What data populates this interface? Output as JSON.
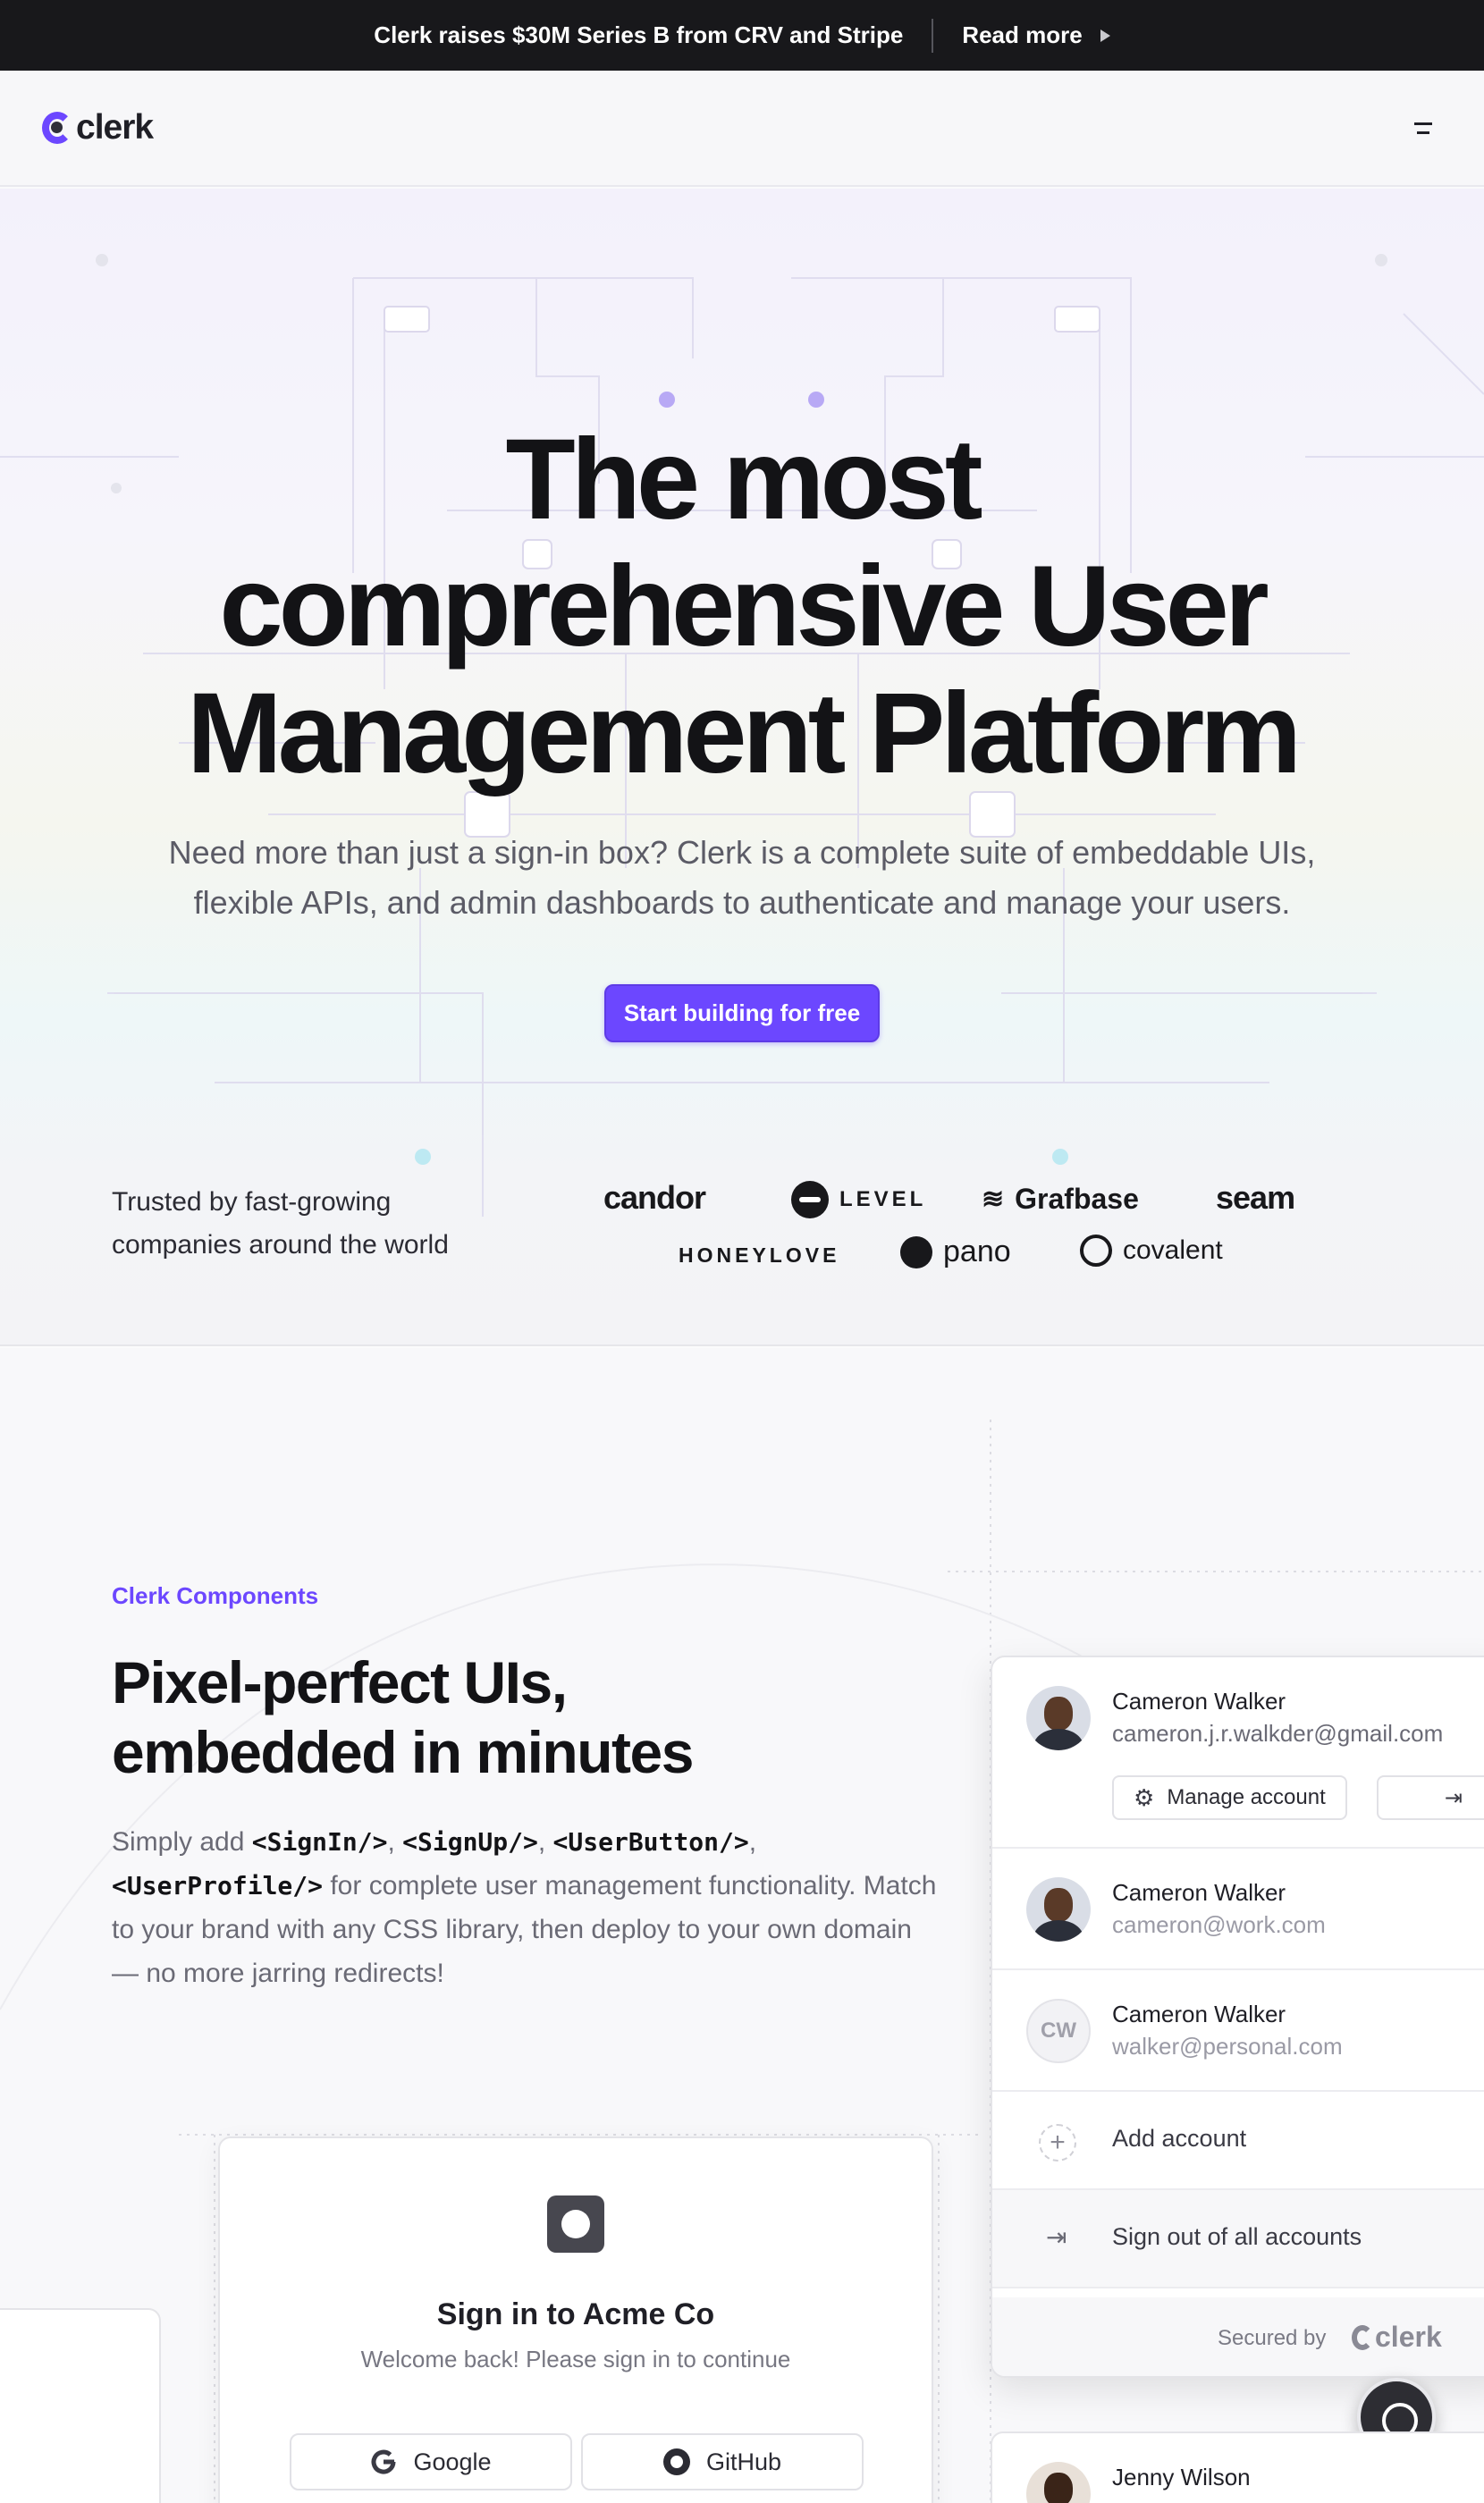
{
  "announcement": {
    "text": "Clerk raises $30M Series B from CRV and Stripe",
    "link": "Read more"
  },
  "nav": {
    "logo_text": "clerk"
  },
  "hero": {
    "title_lines": [
      "The most",
      "comprehensive User",
      "Management Platform"
    ],
    "subtitle_lines": [
      "Need more than just a sign-in box? Clerk is a complete suite of embeddable UIs,",
      "flexible APIs, and admin dashboards to authenticate and manage your users."
    ],
    "cta": "Start building for free",
    "trusted_lines": [
      "Trusted by fast-growing",
      "companies around the world"
    ],
    "brands": [
      "candor",
      "LEVEL",
      "Grafbase",
      "seam",
      "HONEYLOVE",
      "pano",
      "covalent"
    ]
  },
  "features": {
    "eyebrow": "Clerk Components",
    "title_lines": [
      "Pixel-perfect UIs,",
      "embedded in minutes"
    ],
    "body": {
      "simply": "Simply add ",
      "c1": "<SignIn/>",
      "c2": "<SignUp/>",
      "c3": "<UserButton/>",
      "c4": "<UserProfile/>",
      "comma": ", ",
      "rest": " for complete user management functionality. Match to your brand with any CSS library, then deploy to your own domain — no more jarring redirects!"
    }
  },
  "signin_card": {
    "title": "Sign in to Acme Co",
    "subtitle": "Welcome back! Please sign in to continue",
    "google": "Google",
    "github": "GitHub"
  },
  "user_button": {
    "active": {
      "name": "Cameron Walker",
      "email": "cameron.j.r.walkder@gmail.com"
    },
    "manage": "Manage account",
    "accounts": [
      {
        "name": "Cameron Walker",
        "email": "cameron@work.com"
      },
      {
        "name": "Cameron Walker",
        "email": "walker@personal.com",
        "initials": "CW"
      }
    ],
    "add_account": "Add account",
    "sign_out_all": "Sign out of all accounts",
    "secured_by": "Secured by",
    "secured_logo": "clerk"
  },
  "next_user": {
    "name": "Jenny Wilson"
  },
  "colors": {
    "accent": "#6c47ff",
    "dark": "#18181b"
  }
}
